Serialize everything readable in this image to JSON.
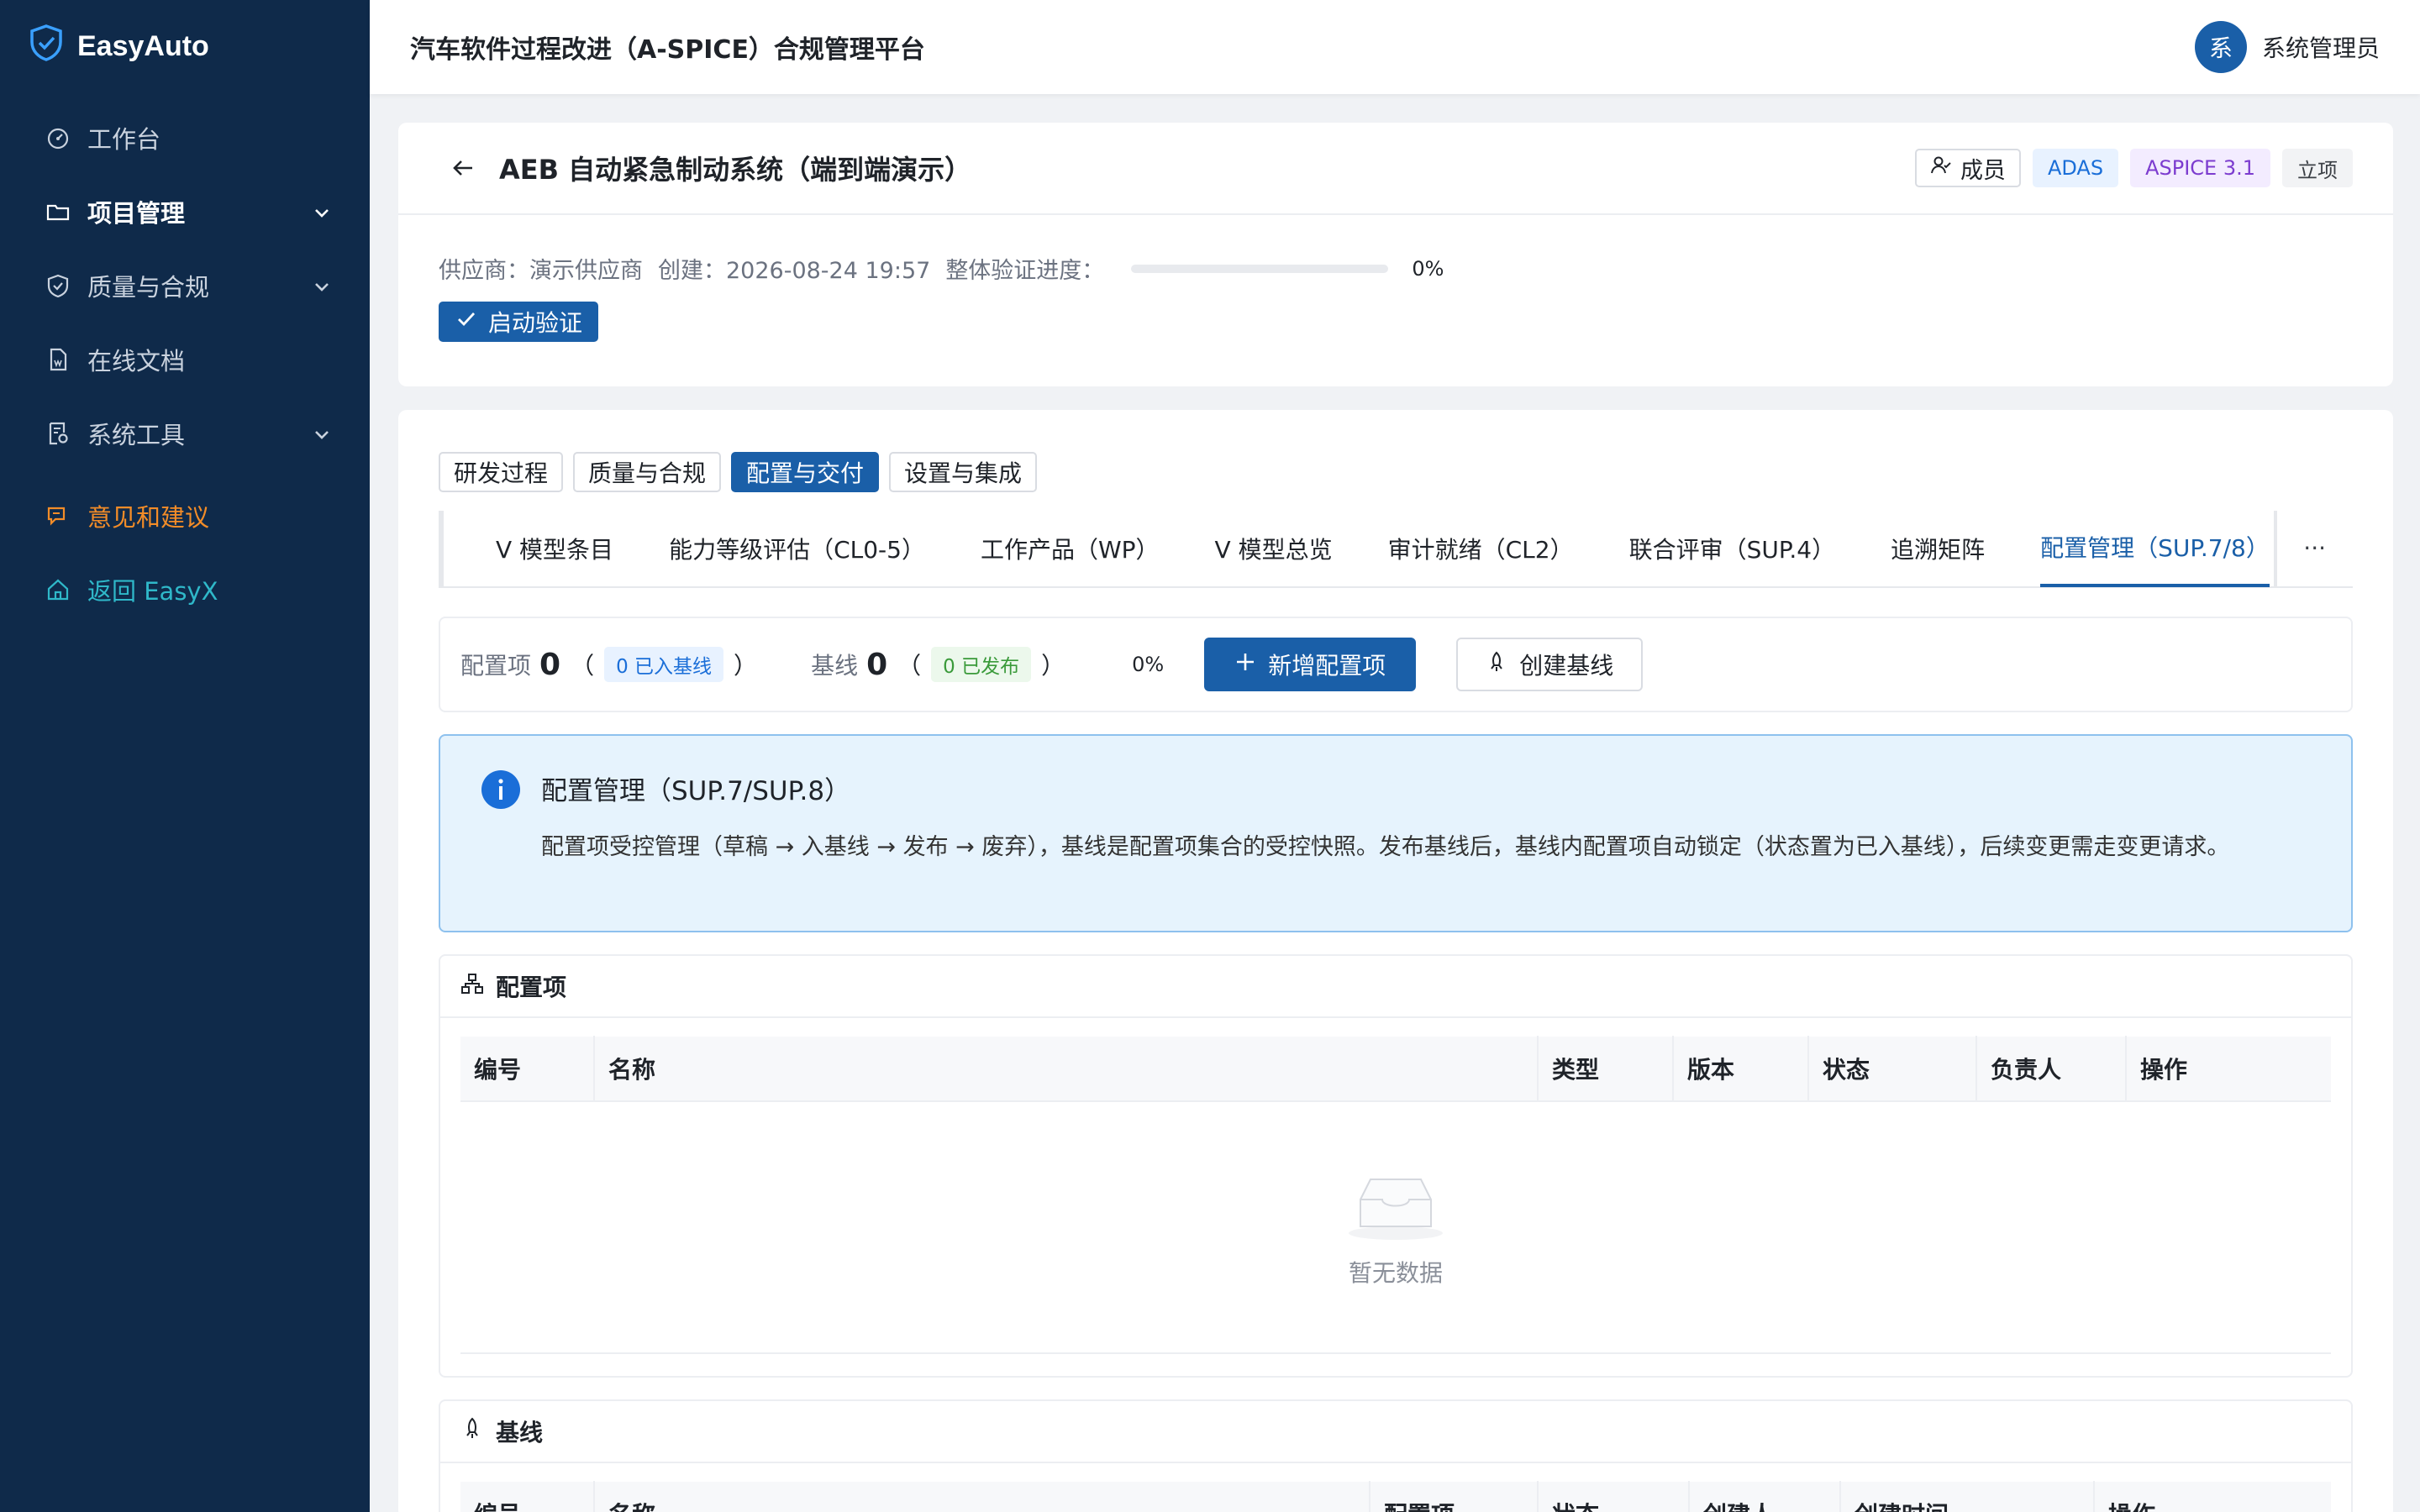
{
  "app": {
    "brand": "EasyAuto",
    "platform_title": "汽车软件过程改进（A-SPICE）合规管理平台"
  },
  "colors": {
    "sidebar_bg": "#0f2a4a",
    "primary": "#1a5fa8",
    "feedback": "#f28c28",
    "return": "#2fb8c9"
  },
  "sidebar": {
    "items": [
      {
        "label": "工作台",
        "icon": "dashboard-icon"
      },
      {
        "label": "项目管理",
        "icon": "folder-icon",
        "expandable": true
      },
      {
        "label": "质量与合规",
        "icon": "shield-icon",
        "expandable": true
      },
      {
        "label": "在线文档",
        "icon": "document-icon"
      },
      {
        "label": "系统工具",
        "icon": "tools-icon",
        "expandable": true
      },
      {
        "label": "意见和建议",
        "icon": "chat-icon"
      },
      {
        "label": "返回 EasyX",
        "icon": "home-icon"
      }
    ]
  },
  "user": {
    "avatar_text": "系",
    "name": "系统管理员"
  },
  "project": {
    "title": "AEB 自动紧急制动系统（端到端演示）",
    "members_label": "成员",
    "tags": [
      "ADAS",
      "ASPICE 3.1",
      "立项"
    ],
    "supplier_label": "供应商：演示供应商",
    "created_label": "创建：2026-08-24 19:57",
    "progress_label": "整体验证进度：",
    "progress_value": "0%",
    "progress_fraction": 0,
    "verify_button": "启动验证"
  },
  "segments": [
    "研发过程",
    "质量与合规",
    "配置与交付",
    "设置与集成"
  ],
  "active_segment": "配置与交付",
  "sub_tabs": [
    "V 模型条目",
    "能力等级评估（CL0-5）",
    "工作产品（WP）",
    "V 模型总览",
    "审计就绪（CL2）",
    "联合评审（SUP.4）",
    "追溯矩阵",
    "配置管理（SUP.7/8）"
  ],
  "active_sub_tab": "配置管理（SUP.7/8）",
  "more_label": "···",
  "stats": {
    "config_label": "配置项",
    "config_count": "0",
    "config_pill": "0 已入基线",
    "baseline_label": "基线",
    "baseline_count": "0",
    "baseline_pill": "0 已发布",
    "open_paren": "（",
    "close_paren": "）",
    "percent": "0%",
    "add_button": "新增配置项",
    "baseline_button": "创建基线"
  },
  "info": {
    "title": "配置管理（SUP.7/SUP.8）",
    "text": "配置项受控管理（草稿 → 入基线 → 发布 → 废弃），基线是配置项集合的受控快照。发布基线后，基线内配置项自动锁定（状态置为已入基线），后续变更需走变更请求。"
  },
  "config_section": {
    "title": "配置项",
    "columns": [
      "编号",
      "名称",
      "类型",
      "版本",
      "状态",
      "负责人",
      "操作"
    ],
    "empty_text": "暂无数据"
  },
  "baseline_section": {
    "title": "基线",
    "columns": [
      "编号",
      "名称",
      "配置项",
      "状态",
      "创建人",
      "创建时间",
      "操作"
    ]
  }
}
